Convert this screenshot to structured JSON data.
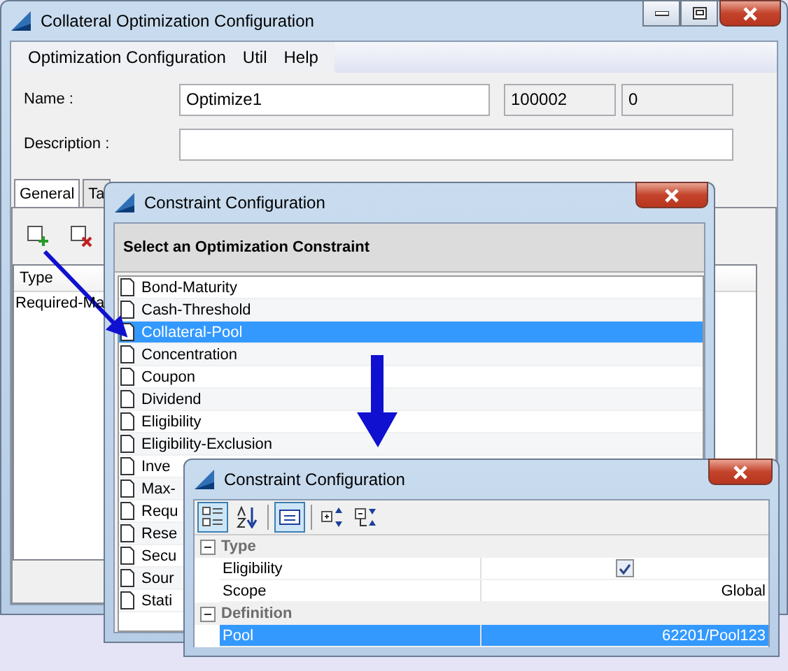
{
  "main_window": {
    "title": "Collateral Optimization Configuration",
    "menu": [
      "Optimization Configuration",
      "Util",
      "Help"
    ],
    "name_label": "Name :",
    "name_value": "Optimize1",
    "id_value": "100002",
    "version_value": "0",
    "description_label": "Description :",
    "tabs": [
      {
        "label": "General",
        "selected": true
      },
      {
        "label": "Ta",
        "selected": false
      }
    ],
    "table": {
      "columns": [
        "Type"
      ],
      "rows": [
        "Required-Ma"
      ]
    }
  },
  "constraint_dialog": {
    "title": "Constraint Configuration",
    "heading": "Select an Optimization Constraint",
    "items": [
      {
        "label": "Bond-Maturity",
        "selected": false
      },
      {
        "label": "Cash-Threshold",
        "selected": false
      },
      {
        "label": "Collateral-Pool",
        "selected": true
      },
      {
        "label": "Concentration",
        "selected": false
      },
      {
        "label": "Coupon",
        "selected": false
      },
      {
        "label": "Dividend",
        "selected": false
      },
      {
        "label": "Eligibility",
        "selected": false
      },
      {
        "label": "Eligibility-Exclusion",
        "selected": false
      },
      {
        "label": "Inve",
        "selected": false
      },
      {
        "label": "Max-",
        "selected": false
      },
      {
        "label": "Requ",
        "selected": false
      },
      {
        "label": "Rese",
        "selected": false
      },
      {
        "label": "Secu",
        "selected": false
      },
      {
        "label": "Sour",
        "selected": false
      },
      {
        "label": "Stati",
        "selected": false
      }
    ]
  },
  "property_dialog": {
    "title": "Constraint Configuration",
    "toolbar": [
      {
        "kind": "categorized",
        "selected": true
      },
      {
        "kind": "alphabetical",
        "selected": false
      },
      {
        "kind": "pages",
        "selected": true
      },
      {
        "kind": "expand",
        "selected": false
      },
      {
        "kind": "collapse",
        "selected": false
      }
    ],
    "categories": [
      {
        "label": "Type",
        "expanded": true,
        "properties": [
          {
            "name": "Eligibility",
            "kind": "checkbox",
            "checked": true,
            "selected": false
          },
          {
            "name": "Scope",
            "kind": "text",
            "value": "Global",
            "selected": false
          }
        ]
      },
      {
        "label": "Definition",
        "expanded": true,
        "properties": [
          {
            "name": "Pool",
            "kind": "text",
            "value": "62201/Pool123",
            "selected": true
          }
        ]
      }
    ]
  }
}
